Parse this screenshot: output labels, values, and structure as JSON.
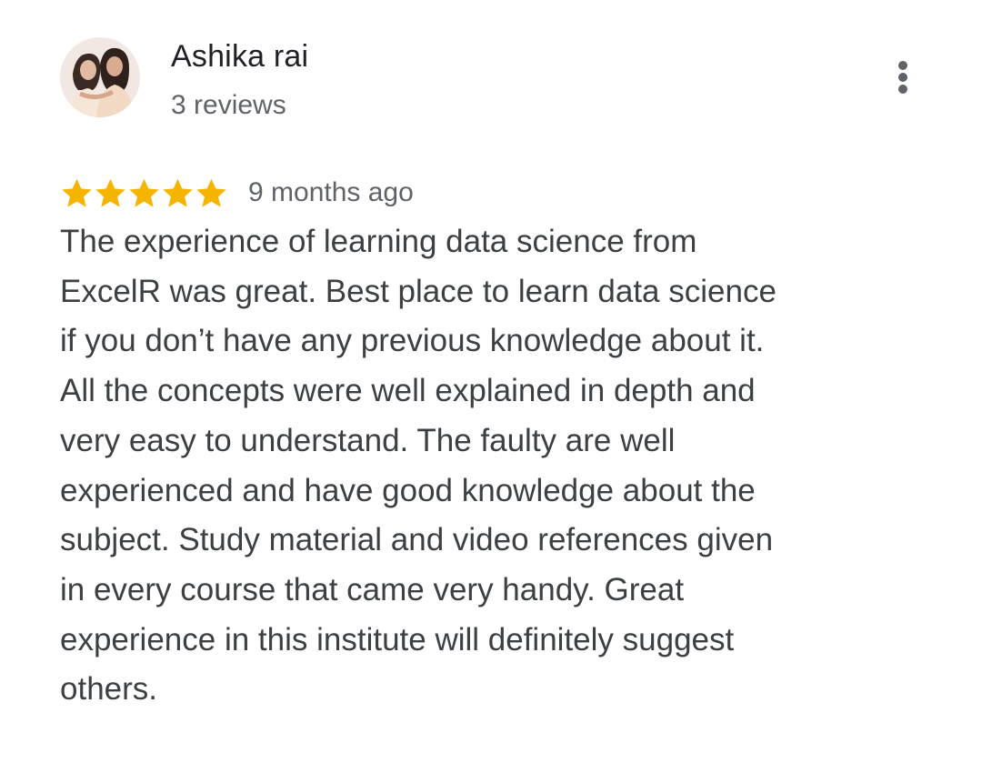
{
  "reviewer": {
    "name": "Ashika rai",
    "review_count": "3 reviews",
    "avatar": "profile-photo"
  },
  "menu": {
    "icon": "more-vertical-icon"
  },
  "rating": {
    "stars": 5,
    "max_stars": 5,
    "star_color": "#f4b400",
    "date": "9 months ago"
  },
  "review": {
    "lines": [
      "The experience of learning data science from",
      "ExcelR was great. Best place to learn data science",
      "if you don’t have any previous knowledge about it.",
      "All the concepts were well explained in depth and",
      "very easy to understand. The faulty are well",
      "experienced and have good knowledge about the",
      "subject. Study material and video references given",
      "in every course that came very handy. Great",
      "experience in this institute will definitely suggest",
      "others."
    ]
  },
  "colors": {
    "name": "#202124",
    "secondary_text": "#5f6368",
    "body_text": "#3c4043",
    "background": "#ffffff"
  }
}
